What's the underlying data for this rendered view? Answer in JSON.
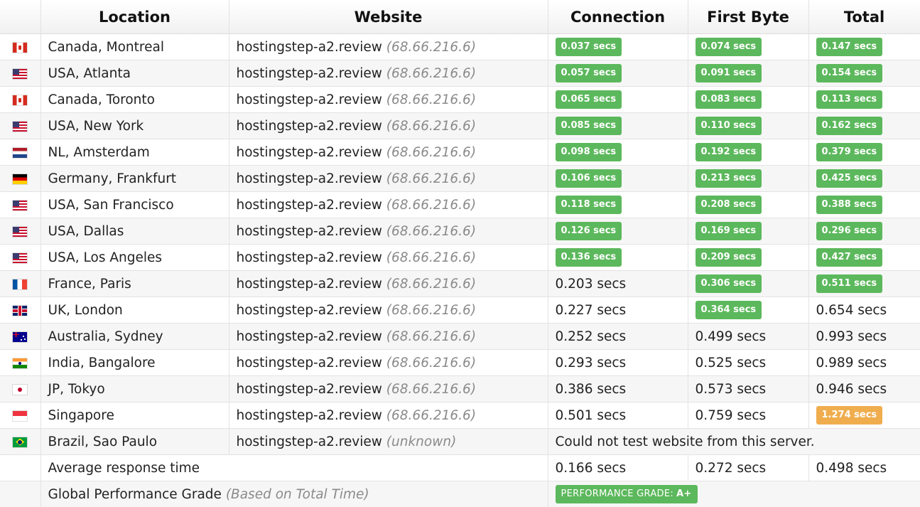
{
  "headers": {
    "location": "Location",
    "website": "Website",
    "connection": "Connection",
    "first_byte": "First Byte",
    "total": "Total"
  },
  "rows": [
    {
      "flag": "canada-flag-icon",
      "location": "Canada, Montreal",
      "site": "hostingstep-a2.review",
      "ip": "(68.66.216.6)",
      "connection": "0.037 secs",
      "first_byte": "0.074 secs",
      "total": "0.147 secs"
    },
    {
      "flag": "usa-flag-icon",
      "location": "USA, Atlanta",
      "site": "hostingstep-a2.review",
      "ip": "(68.66.216.6)",
      "connection": "0.057 secs",
      "first_byte": "0.091 secs",
      "total": "0.154 secs"
    },
    {
      "flag": "canada-flag-icon",
      "location": "Canada, Toronto",
      "site": "hostingstep-a2.review",
      "ip": "(68.66.216.6)",
      "connection": "0.065 secs",
      "first_byte": "0.083 secs",
      "total": "0.113 secs"
    },
    {
      "flag": "usa-flag-icon",
      "location": "USA, New York",
      "site": "hostingstep-a2.review",
      "ip": "(68.66.216.6)",
      "connection": "0.085 secs",
      "first_byte": "0.110 secs",
      "total": "0.162 secs"
    },
    {
      "flag": "netherlands-flag-icon",
      "location": "NL, Amsterdam",
      "site": "hostingstep-a2.review",
      "ip": "(68.66.216.6)",
      "connection": "0.098 secs",
      "first_byte": "0.192 secs",
      "total": "0.379 secs"
    },
    {
      "flag": "germany-flag-icon",
      "location": "Germany, Frankfurt",
      "site": "hostingstep-a2.review",
      "ip": "(68.66.216.6)",
      "connection": "0.106 secs",
      "first_byte": "0.213 secs",
      "total": "0.425 secs"
    },
    {
      "flag": "usa-flag-icon",
      "location": "USA, San Francisco",
      "site": "hostingstep-a2.review",
      "ip": "(68.66.216.6)",
      "connection": "0.118 secs",
      "first_byte": "0.208 secs",
      "total": "0.388 secs"
    },
    {
      "flag": "usa-flag-icon",
      "location": "USA, Dallas",
      "site": "hostingstep-a2.review",
      "ip": "(68.66.216.6)",
      "connection": "0.126 secs",
      "first_byte": "0.169 secs",
      "total": "0.296 secs"
    },
    {
      "flag": "usa-flag-icon",
      "location": "USA, Los Angeles",
      "site": "hostingstep-a2.review",
      "ip": "(68.66.216.6)",
      "connection": "0.136 secs",
      "first_byte": "0.209 secs",
      "total": "0.427 secs"
    },
    {
      "flag": "france-flag-icon",
      "location": "France, Paris",
      "site": "hostingstep-a2.review",
      "ip": "(68.66.216.6)",
      "connection": "0.203 secs",
      "first_byte": "0.306 secs",
      "total": "0.511 secs"
    },
    {
      "flag": "uk-flag-icon",
      "location": "UK, London",
      "site": "hostingstep-a2.review",
      "ip": "(68.66.216.6)",
      "connection": "0.227 secs",
      "first_byte": "0.364 secs",
      "total": "0.654 secs"
    },
    {
      "flag": "australia-flag-icon",
      "location": "Australia, Sydney",
      "site": "hostingstep-a2.review",
      "ip": "(68.66.216.6)",
      "connection": "0.252 secs",
      "first_byte": "0.499 secs",
      "total": "0.993 secs"
    },
    {
      "flag": "india-flag-icon",
      "location": "India, Bangalore",
      "site": "hostingstep-a2.review",
      "ip": "(68.66.216.6)",
      "connection": "0.293 secs",
      "first_byte": "0.525 secs",
      "total": "0.989 secs"
    },
    {
      "flag": "japan-flag-icon",
      "location": "JP, Tokyo",
      "site": "hostingstep-a2.review",
      "ip": "(68.66.216.6)",
      "connection": "0.386 secs",
      "first_byte": "0.573 secs",
      "total": "0.946 secs"
    },
    {
      "flag": "singapore-flag-icon",
      "location": "Singapore",
      "site": "hostingstep-a2.review",
      "ip": "(68.66.216.6)",
      "connection": "0.501 secs",
      "first_byte": "0.759 secs",
      "total": "1.274 secs"
    },
    {
      "flag": "brazil-flag-icon",
      "location": "Brazil, Sao Paulo",
      "site": "hostingstep-a2.review",
      "ip": "(unknown)",
      "error": "Could not test website from this server."
    }
  ],
  "average": {
    "label": "Average response time",
    "connection": "0.166 secs",
    "first_byte": "0.272 secs",
    "total": "0.498 secs"
  },
  "grade": {
    "label": "Global Performance Grade",
    "note": "(Based on Total Time)",
    "badge_text": "PERFORMANCE GRADE:",
    "badge_value": "A+"
  },
  "colors": {
    "good": "#5cb85c",
    "warn": "#f0ad4e"
  }
}
